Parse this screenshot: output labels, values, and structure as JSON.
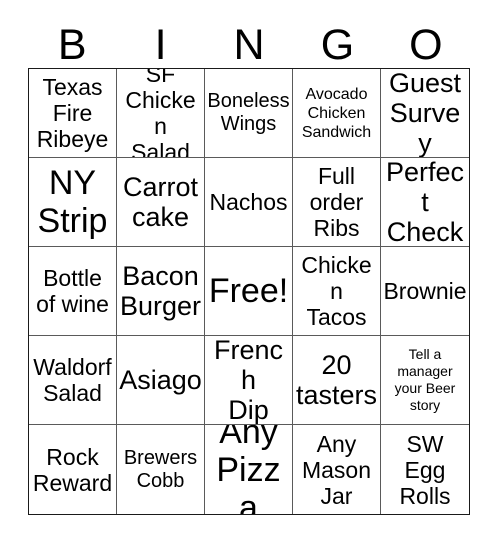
{
  "header": {
    "letters": [
      "B",
      "I",
      "N",
      "G",
      "O"
    ]
  },
  "grid": {
    "rows": 5,
    "columns": 5,
    "cells": [
      {
        "text": "Texas\nFire\nRibeye",
        "size": "fs-md",
        "free": false
      },
      {
        "text": "SF\nChicken\nSalad",
        "size": "fs-md",
        "free": false
      },
      {
        "text": "Boneless\nWings",
        "size": "fs-sm",
        "free": false
      },
      {
        "text": "Avocado\nChicken\nSandwich",
        "size": "fs-xs",
        "free": false
      },
      {
        "text": "Guest\nSurvey",
        "size": "fs-lg",
        "free": false
      },
      {
        "text": "NY\nStrip",
        "size": "fs-xl",
        "free": false
      },
      {
        "text": "Carrot\ncake",
        "size": "fs-lg",
        "free": false
      },
      {
        "text": "Nachos",
        "size": "fs-md",
        "free": false
      },
      {
        "text": "Full\norder\nRibs",
        "size": "fs-md",
        "free": false
      },
      {
        "text": "Perfect\nCheck",
        "size": "fs-lg",
        "free": false
      },
      {
        "text": "Bottle\nof wine",
        "size": "fs-md",
        "free": false
      },
      {
        "text": "Bacon\nBurger",
        "size": "fs-lg",
        "free": false
      },
      {
        "text": "Free!",
        "size": "fs-xl",
        "free": true
      },
      {
        "text": "Chicken\nTacos",
        "size": "fs-md",
        "free": false
      },
      {
        "text": "Brownie",
        "size": "fs-md",
        "free": false
      },
      {
        "text": "Waldorf\nSalad",
        "size": "fs-md",
        "free": false
      },
      {
        "text": "Asiago",
        "size": "fs-lg",
        "free": false
      },
      {
        "text": "French\nDip",
        "size": "fs-lg",
        "free": false
      },
      {
        "text": "20\ntasters",
        "size": "fs-lg",
        "free": false
      },
      {
        "text": "Tell a\nmanager\nyour Beer\nstory",
        "size": "fs-xxs",
        "free": false
      },
      {
        "text": "Rock\nReward",
        "size": "fs-md",
        "free": false
      },
      {
        "text": "Brewers\nCobb",
        "size": "fs-sm",
        "free": false
      },
      {
        "text": "Any\nPizza",
        "size": "fs-xl",
        "free": false
      },
      {
        "text": "Any\nMason\nJar",
        "size": "fs-md",
        "free": false
      },
      {
        "text": "SW\nEgg\nRolls",
        "size": "fs-md",
        "free": false
      }
    ]
  },
  "colors": {
    "background": "#ffffff",
    "text": "#000000",
    "outer_border": "#1a1a1a",
    "inner_grid_line": "#5a5a5a"
  }
}
